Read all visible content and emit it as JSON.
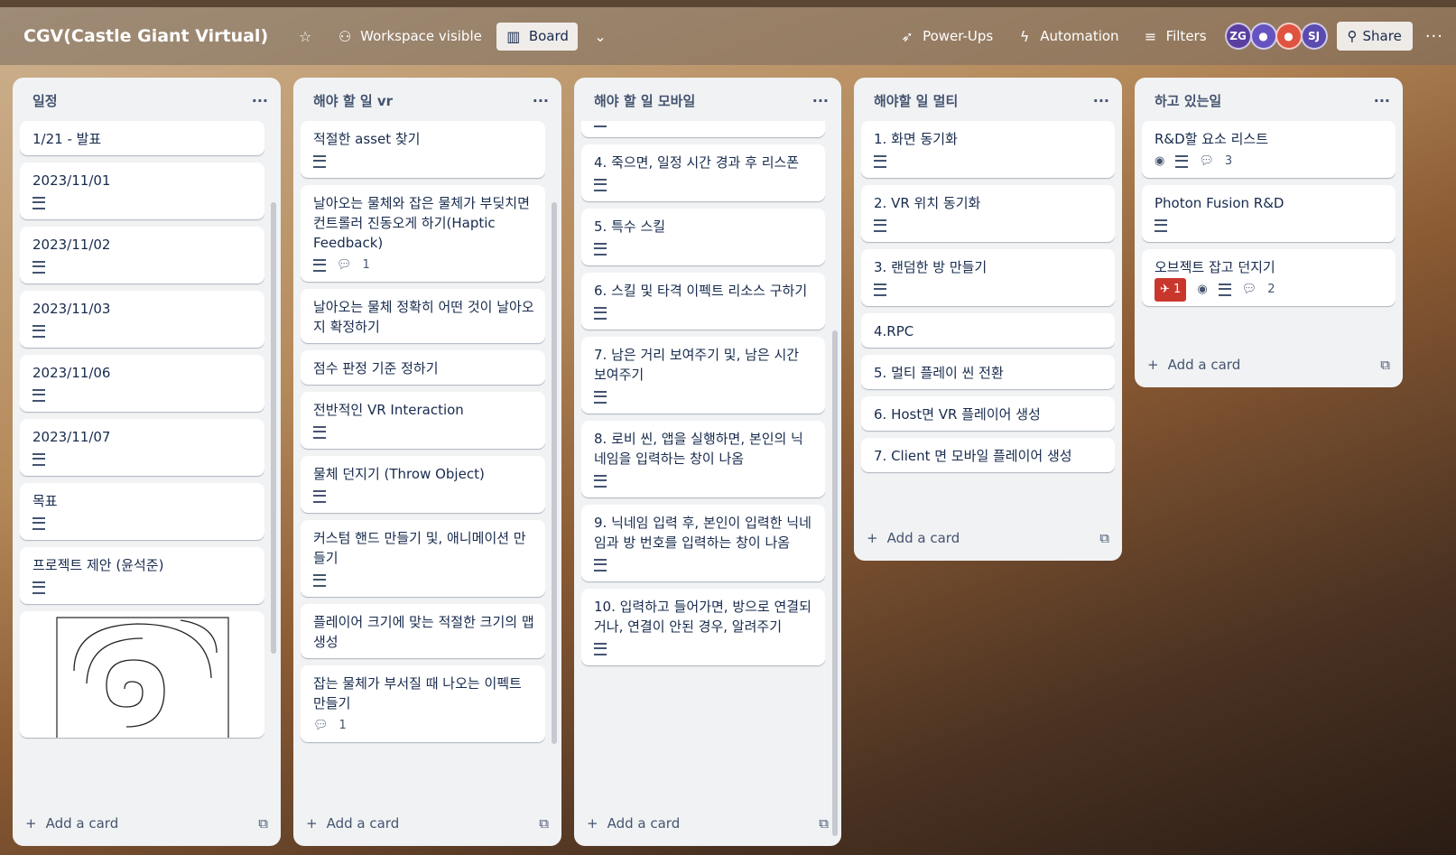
{
  "header": {
    "title": "CGV(Castle Giant Virtual)",
    "visibility": "Workspace visible",
    "view": "Board",
    "powerups": "Power-Ups",
    "automation": "Automation",
    "filters": "Filters",
    "share": "Share",
    "avatars": [
      "ZG",
      "",
      "",
      "SJ"
    ]
  },
  "colors": {
    "accent": "#f1f2f4",
    "badge_red": "#c9372c"
  },
  "add_card": "Add a card",
  "lists": [
    {
      "title": "일정",
      "cards": [
        {
          "title": "1/21 - 발표"
        },
        {
          "title": "2023/11/01"
        },
        {
          "title": "2023/11/02"
        },
        {
          "title": "2023/11/03"
        },
        {
          "title": "2023/11/06"
        },
        {
          "title": "2023/11/07"
        },
        {
          "title": "목표"
        },
        {
          "title": "프로젝트 제안 (윤석준)"
        }
      ]
    },
    {
      "title": "해야 할 일 vr",
      "cards": [
        {
          "title": "적절한 asset 찾기"
        },
        {
          "title": "날아오는 물체와 잡은 물체가 부딪치면 컨트롤러 진동오게 하기(Haptic Feedback)",
          "comments": "1"
        },
        {
          "title": "날아오는 물체 정확히 어떤 것이 날아오지 확정하기"
        },
        {
          "title": "점수 판정 기준 정하기"
        },
        {
          "title": "전반적인 VR Interaction"
        },
        {
          "title": "물체 던지기 (Throw Object)"
        },
        {
          "title": "커스텀 핸드 만들기 및, 애니메이션 만들기"
        },
        {
          "title": "플레이어 크기에 맞는 적절한 크기의 맵 생성"
        },
        {
          "title": "잡는 물체가 부서질 때 나오는 이펙트 만들기",
          "comments": "1"
        }
      ]
    },
    {
      "title": "해야 할 일 모바일",
      "cards": [
        {
          "title": "4. 죽으면, 일정 시간 경과 후 리스폰"
        },
        {
          "title": "5. 특수 스킬"
        },
        {
          "title": "6. 스킬 및 타격 이펙트 리소스 구하기"
        },
        {
          "title": "7. 남은 거리 보여주기 및, 남은 시간 보여주기"
        },
        {
          "title": "8. 로비 씬, 앱을 실행하면, 본인의 닉네임을 입력하는 창이 나옴"
        },
        {
          "title": "9. 닉네임 입력 후, 본인이 입력한 닉네임과 방 번호를 입력하는 창이 나옴"
        },
        {
          "title": "10. 입력하고 들어가면, 방으로 연결되거나, 연결이 안된 경우, 알려주기"
        }
      ]
    },
    {
      "title": "해야할 일 멀티",
      "cards": [
        {
          "title": "1. 화면 동기화"
        },
        {
          "title": "2. VR 위치 동기화"
        },
        {
          "title": "3. 랜덤한 방 만들기"
        },
        {
          "title": "4.RPC"
        },
        {
          "title": "5. 멀티 플레이 씬 전환"
        },
        {
          "title": "6. Host면 VR 플레이어 생성"
        },
        {
          "title": "7. Client 면 모바일 플레이어 생성"
        }
      ]
    },
    {
      "title": "하고 있는일",
      "cards": [
        {
          "title": "R&D할 요소 리스트",
          "comments": "3"
        },
        {
          "title": "Photon Fusion R&D"
        },
        {
          "title": "오브젝트 잡고 던지기",
          "pins": "1",
          "comments": "2"
        }
      ]
    }
  ]
}
